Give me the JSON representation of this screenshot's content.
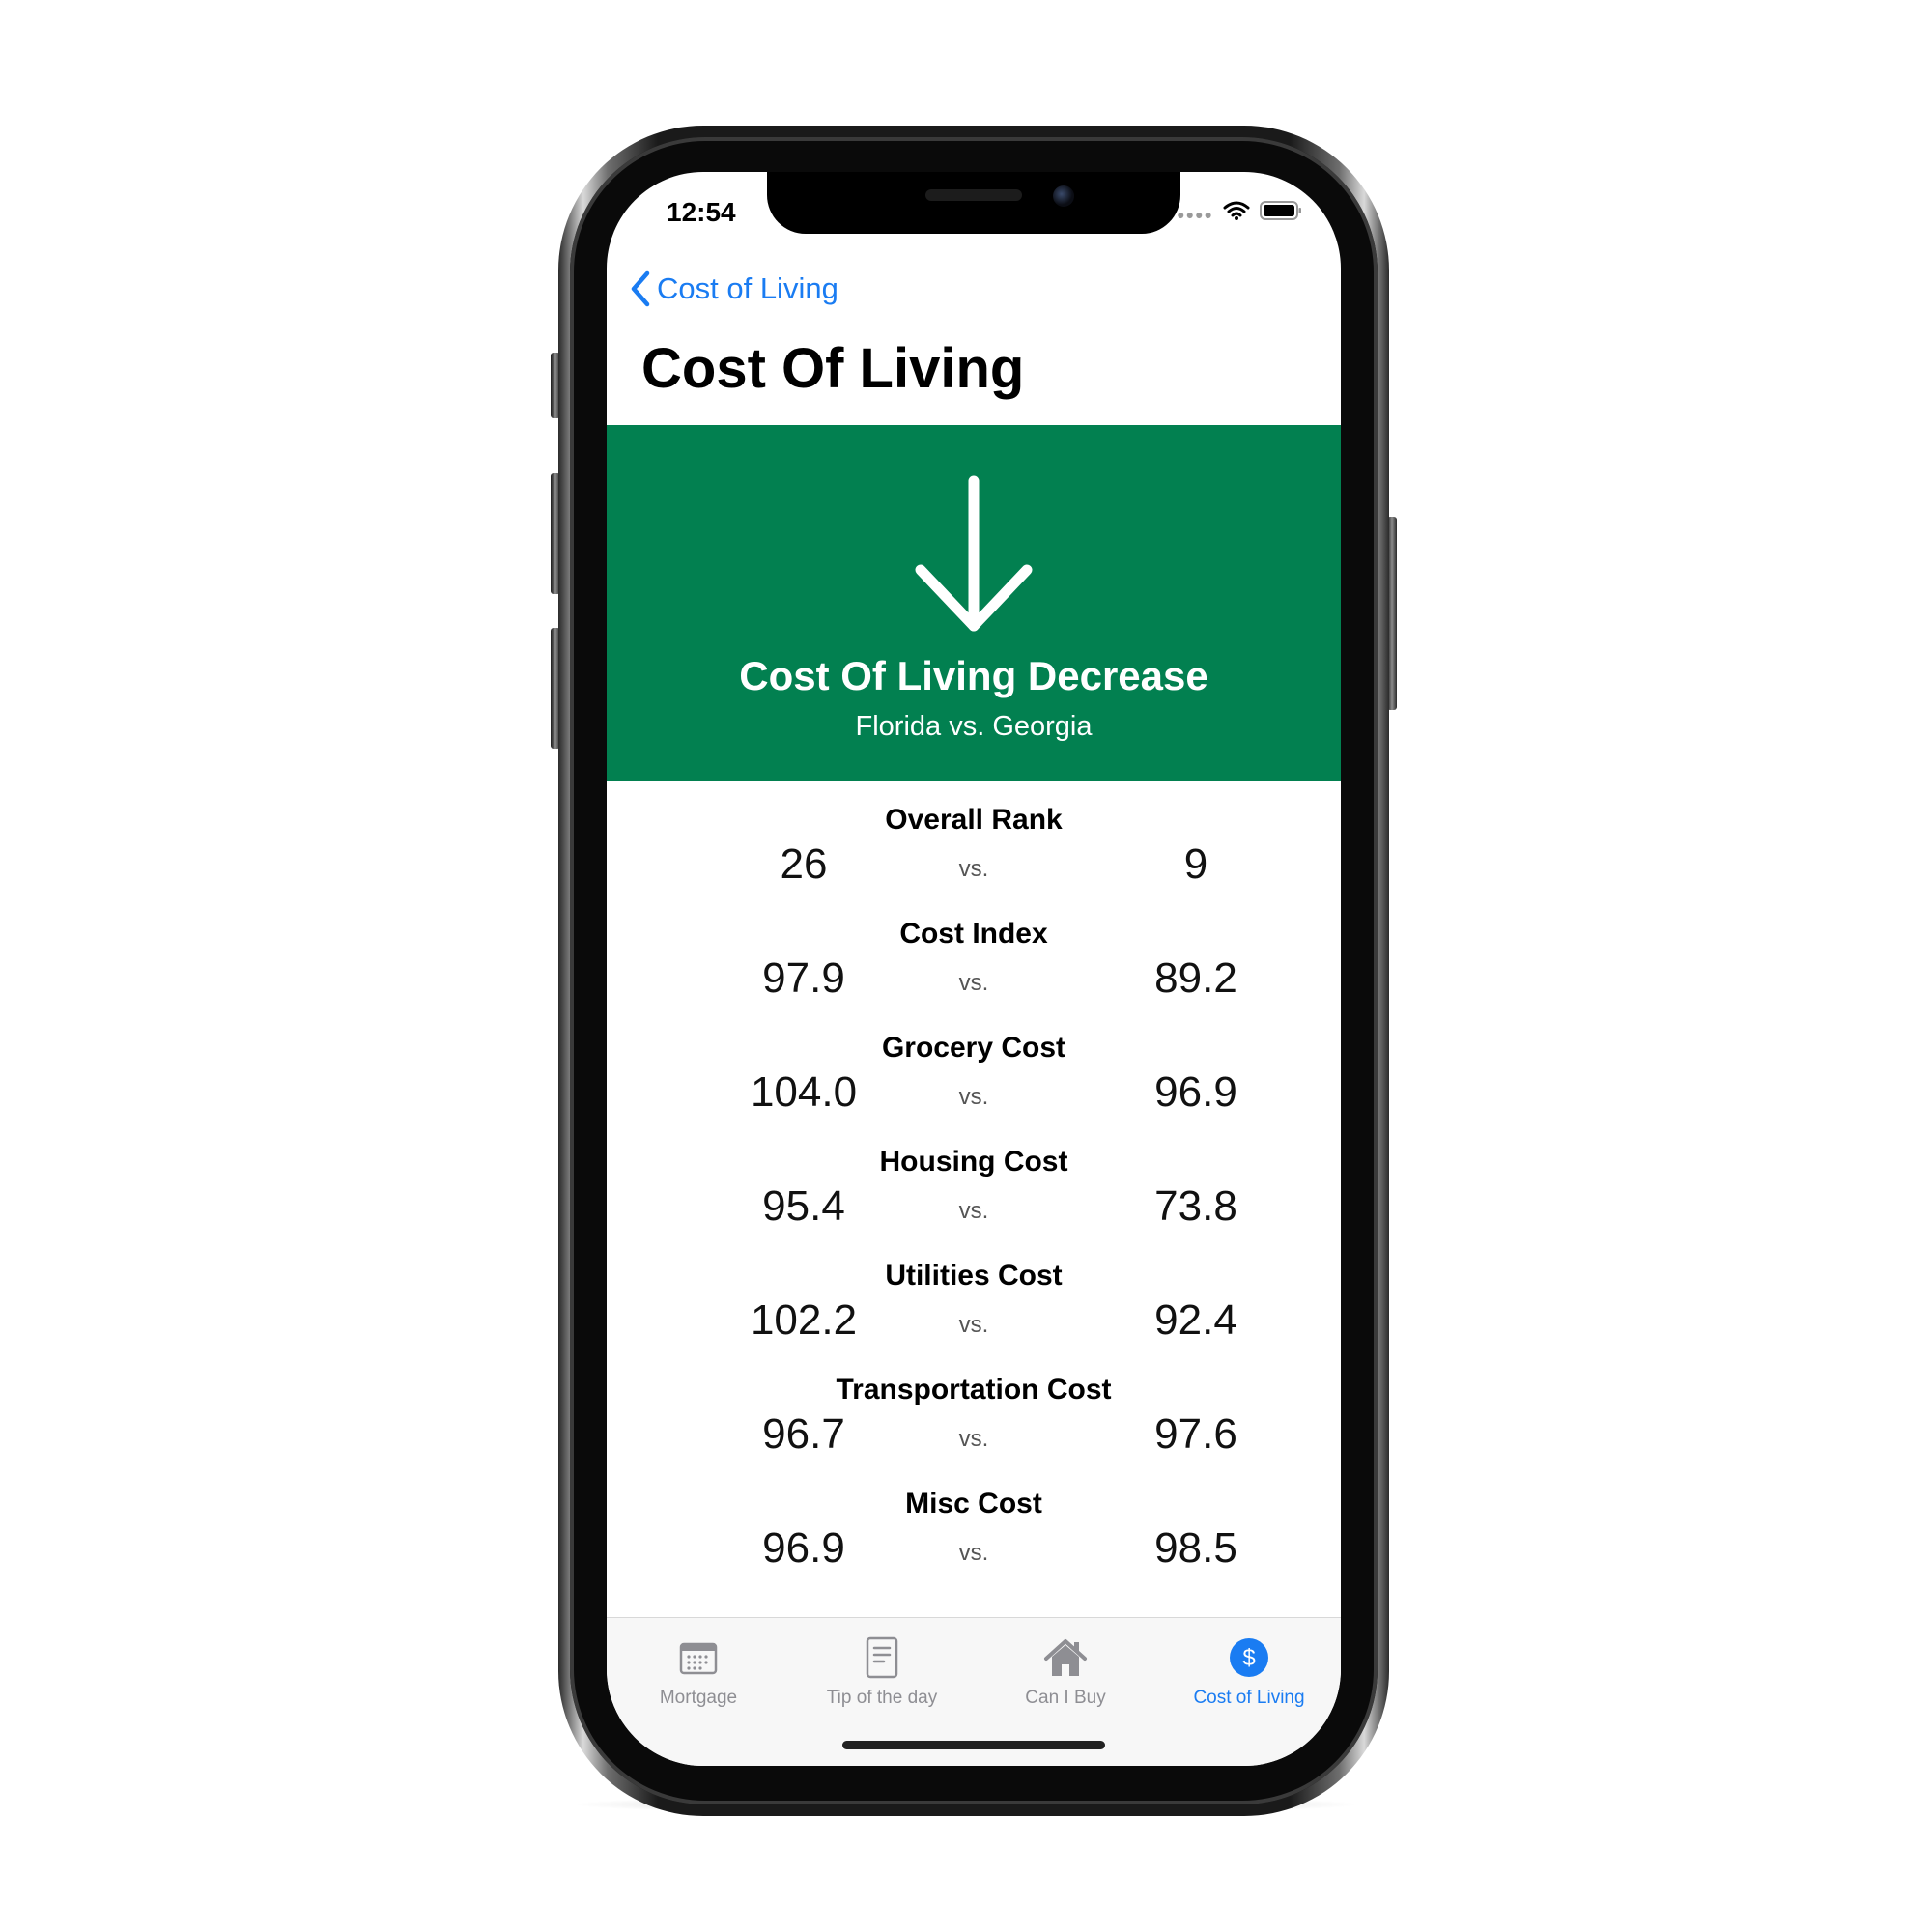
{
  "status_bar": {
    "time": "12:54"
  },
  "nav": {
    "back_label": "Cost of Living",
    "title": "Cost Of Living"
  },
  "banner": {
    "title": "Cost Of Living Decrease",
    "subtitle": "Florida vs. Georgia",
    "color": "#028050",
    "icon": "arrow-down-icon"
  },
  "separator": "vs.",
  "rows": [
    {
      "label": "Overall Rank",
      "left": "26",
      "right": "9"
    },
    {
      "label": "Cost Index",
      "left": "97.9",
      "right": "89.2"
    },
    {
      "label": "Grocery Cost",
      "left": "104.0",
      "right": "96.9"
    },
    {
      "label": "Housing Cost",
      "left": "95.4",
      "right": "73.8"
    },
    {
      "label": "Utilities Cost",
      "left": "102.2",
      "right": "92.4"
    },
    {
      "label": "Transportation Cost",
      "left": "96.7",
      "right": "97.6"
    },
    {
      "label": "Misc Cost",
      "left": "96.9",
      "right": "98.5"
    }
  ],
  "tabs": [
    {
      "label": "Mortgage",
      "icon": "calendar-icon",
      "active": false
    },
    {
      "label": "Tip of the day",
      "icon": "document-icon",
      "active": false
    },
    {
      "label": "Can I Buy",
      "icon": "house-icon",
      "active": false
    },
    {
      "label": "Cost of Living",
      "icon": "dollar-circle-icon",
      "active": true
    }
  ],
  "colors": {
    "accent": "#1a7cf2",
    "inactive_tab": "#8e8e93"
  }
}
